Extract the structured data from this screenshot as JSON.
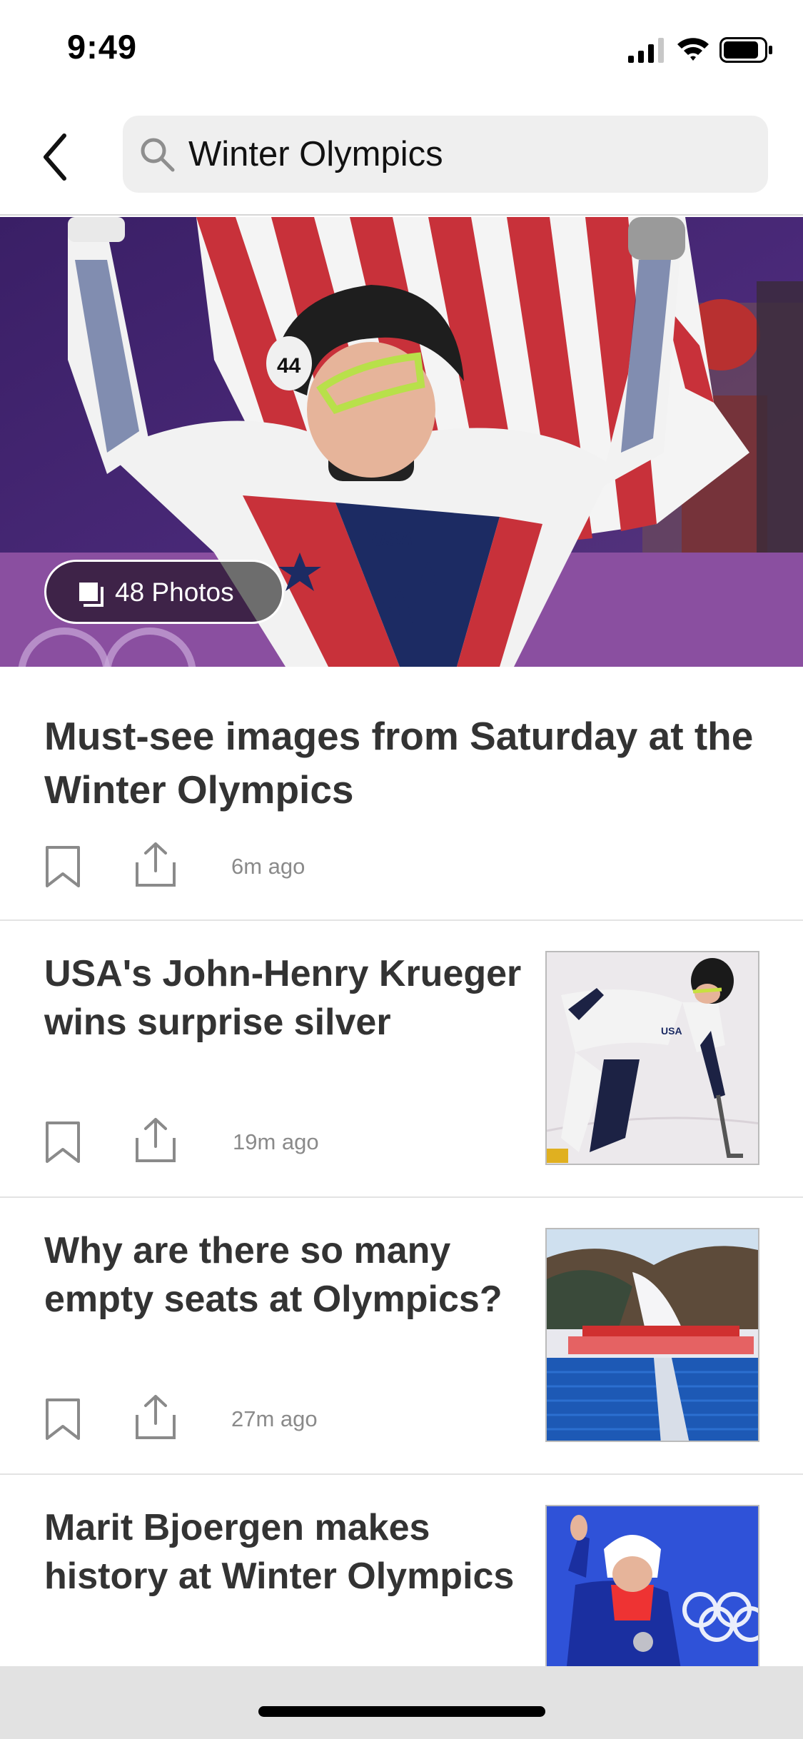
{
  "status_bar": {
    "time": "9:49"
  },
  "search": {
    "query": "Winter Olympics"
  },
  "hero": {
    "photos_badge": "48 Photos"
  },
  "articles": [
    {
      "title": "Must-see images from Saturday at the Winter Olympics",
      "time": "6m ago"
    },
    {
      "title": "USA's John-Henry Krueger wins surprise silver",
      "time": "19m ago"
    },
    {
      "title": "Why are there so many empty seats at Olympics?",
      "time": "27m ago"
    },
    {
      "title": "Marit Bjoergen makes history at Winter Olympics",
      "time": ""
    }
  ],
  "colors": {
    "title_text": "#333333",
    "meta_text": "#8a8a8a",
    "search_bg": "#efefef",
    "divider": "#e3e3e3"
  },
  "icons": [
    "back-chevron-icon",
    "search-icon",
    "gallery-icon",
    "bookmark-icon",
    "share-icon",
    "signal-icon",
    "wifi-icon",
    "battery-icon"
  ]
}
